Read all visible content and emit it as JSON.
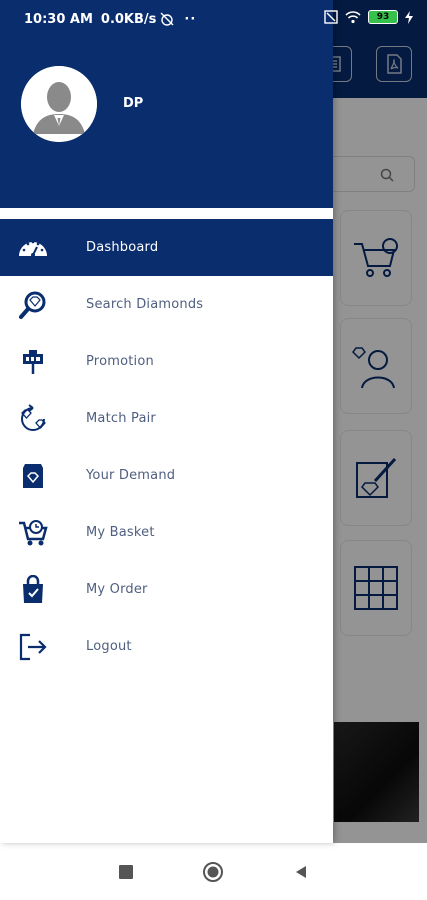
{
  "status_bar": {
    "time": "10:30 AM",
    "speed": "0.0KB/s",
    "extra": "··",
    "battery": "93"
  },
  "colors": {
    "primary": "#0a2d6e",
    "menu_text": "#4f5f80",
    "active_text": "#ffffff"
  },
  "drawer": {
    "user_name": "DP",
    "menu": [
      {
        "label": "Dashboard",
        "icon": "dashboard-gauge-icon",
        "active": true
      },
      {
        "label": "Search Diamonds",
        "icon": "search-diamond-icon",
        "active": false
      },
      {
        "label": "Promotion",
        "icon": "promotion-sign-icon",
        "active": false
      },
      {
        "label": "Match Pair",
        "icon": "match-pair-icon",
        "active": false
      },
      {
        "label": "Your Demand",
        "icon": "demand-box-icon",
        "active": false
      },
      {
        "label": "My Basket",
        "icon": "basket-cart-icon",
        "active": false
      },
      {
        "label": "My Order",
        "icon": "order-bag-icon",
        "active": false
      },
      {
        "label": "Logout",
        "icon": "logout-icon",
        "active": false
      }
    ]
  },
  "nav_bar": {
    "buttons": [
      "recents-button",
      "home-button",
      "back-button"
    ]
  }
}
